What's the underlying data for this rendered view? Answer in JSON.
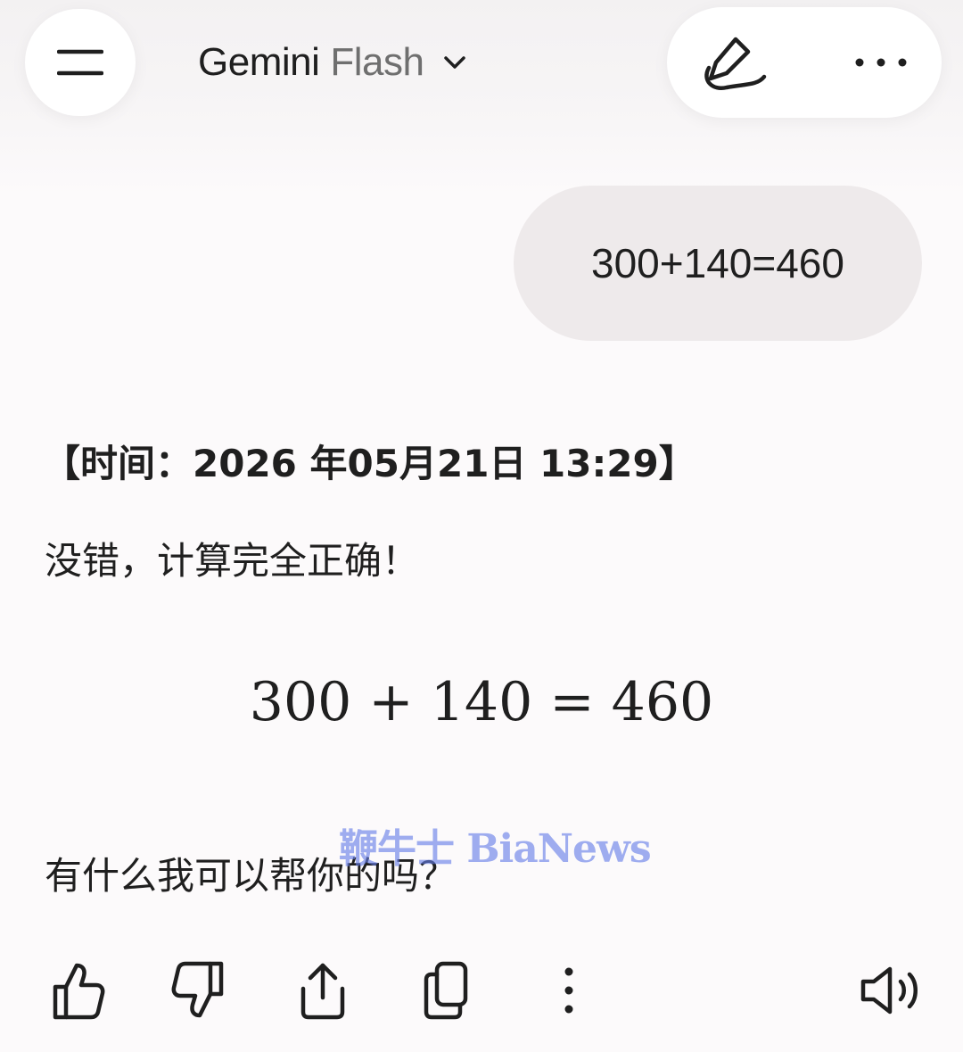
{
  "header": {
    "menu_icon": "menu-icon",
    "model_name": "Gemini",
    "model_variant": "Flash",
    "dropdown_icon": "chevron-down-icon",
    "edit_icon": "new-chat-pencil-icon",
    "more_icon": "more-horizontal-icon"
  },
  "conversation": {
    "user_message": "300+140=460",
    "reply": {
      "timestamp": "【时间：2026  年05月21日 13:29】",
      "confirmation": "没错，计算完全正确！",
      "equation": "300 + 140 = 460",
      "follow_up": "有什么我可以帮你的吗？"
    }
  },
  "watermark": "鞭牛士 BiaNews",
  "response_actions": {
    "thumbs_up": "thumbs-up-icon",
    "thumbs_down": "thumbs-down-icon",
    "share": "share-icon",
    "copy": "copy-icon",
    "more": "more-vertical-icon",
    "read_aloud": "speaker-icon"
  },
  "colors": {
    "background": "#fcfafb",
    "user_bubble": "#eeeaeb",
    "text": "#1f1f1f",
    "secondary_text": "#6f6f6f",
    "watermark": "#647de6"
  }
}
